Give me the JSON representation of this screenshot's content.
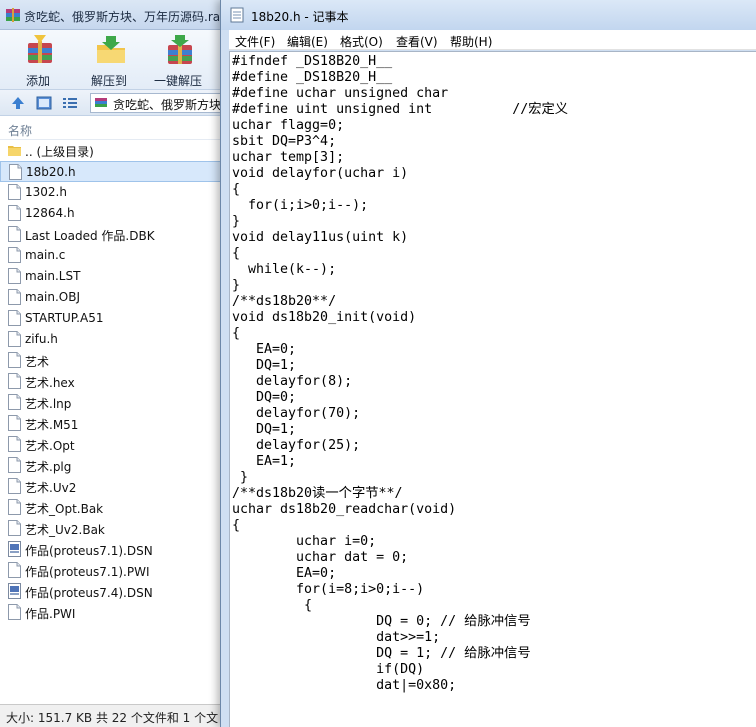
{
  "archive": {
    "title": "贪吃蛇、俄罗斯方块、万年历源码.ra",
    "toolbar": [
      {
        "label": "添加",
        "icon": "add-books-icon"
      },
      {
        "label": "解压到",
        "icon": "extract-folder-icon"
      },
      {
        "label": "一键解压",
        "icon": "quick-extract-icon"
      }
    ],
    "address": "贪吃蛇、俄罗斯方块",
    "column_header": "名称",
    "files": [
      {
        "name": ".. (上级目录)",
        "icon": "folder-up-icon"
      },
      {
        "name": "18b20.h",
        "icon": "file-icon",
        "selected": true
      },
      {
        "name": "1302.h",
        "icon": "file-icon"
      },
      {
        "name": "12864.h",
        "icon": "file-icon"
      },
      {
        "name": "Last Loaded 作品.DBK",
        "icon": "file-icon"
      },
      {
        "name": "main.c",
        "icon": "file-icon"
      },
      {
        "name": "main.LST",
        "icon": "file-icon"
      },
      {
        "name": "main.OBJ",
        "icon": "file-icon"
      },
      {
        "name": "STARTUP.A51",
        "icon": "file-icon"
      },
      {
        "name": "zifu.h",
        "icon": "file-icon"
      },
      {
        "name": "艺术",
        "icon": "file-icon"
      },
      {
        "name": "艺术.hex",
        "icon": "file-icon"
      },
      {
        "name": "艺术.lnp",
        "icon": "file-icon"
      },
      {
        "name": "艺术.M51",
        "icon": "file-icon"
      },
      {
        "name": "艺术.Opt",
        "icon": "file-icon"
      },
      {
        "name": "艺术.plg",
        "icon": "file-icon"
      },
      {
        "name": "艺术.Uv2",
        "icon": "file-icon"
      },
      {
        "name": "艺术_Opt.Bak",
        "icon": "file-icon"
      },
      {
        "name": "艺术_Uv2.Bak",
        "icon": "file-icon"
      },
      {
        "name": "作品(proteus7.1).DSN",
        "icon": "dsn-file-icon"
      },
      {
        "name": "作品(proteus7.1).PWI",
        "icon": "file-icon"
      },
      {
        "name": "作品(proteus7.4).DSN",
        "icon": "dsn-file-icon"
      },
      {
        "name": "作品.PWI",
        "icon": "file-icon"
      }
    ],
    "status": "大小: 151.7 KB 共 22 个文件和 1 个文"
  },
  "notepad": {
    "title": "18b20.h - 记事本",
    "menu": [
      "文件(F)",
      "编辑(E)",
      "格式(O)",
      "查看(V)",
      "帮助(H)"
    ],
    "lines": [
      "#ifndef _DS18B20_H__",
      "#define _DS18B20_H__",
      "#define uchar unsigned char",
      "#define uint unsigned int          //宏定义",
      "uchar flagg=0;",
      "sbit DQ=P3^4;",
      "uchar temp[3];",
      "void delayfor(uchar i)",
      "{",
      "  for(i;i>0;i--);",
      "}",
      "void delay11us(uint k)",
      "{",
      "  while(k--);",
      "}",
      "/**ds18b20**/",
      "void ds18b20_init(void)",
      "{",
      "   EA=0;",
      "   DQ=1;",
      "   delayfor(8);",
      "   DQ=0;",
      "   delayfor(70);",
      "   DQ=1;",
      "   delayfor(25);",
      "   EA=1;",
      " }",
      "/**ds18b20读一个字节**/",
      "uchar ds18b20_readchar(void)",
      "{",
      "        uchar i=0;",
      "        uchar dat = 0;",
      "        EA=0;",
      "        for(i=8;i>0;i--)",
      "         {",
      "                  DQ = 0; // 给脉冲信号",
      "                  dat>>=1;",
      "                  DQ = 1; // 给脉冲信号",
      "                  if(DQ)",
      "                  dat|=0x80;"
    ]
  }
}
